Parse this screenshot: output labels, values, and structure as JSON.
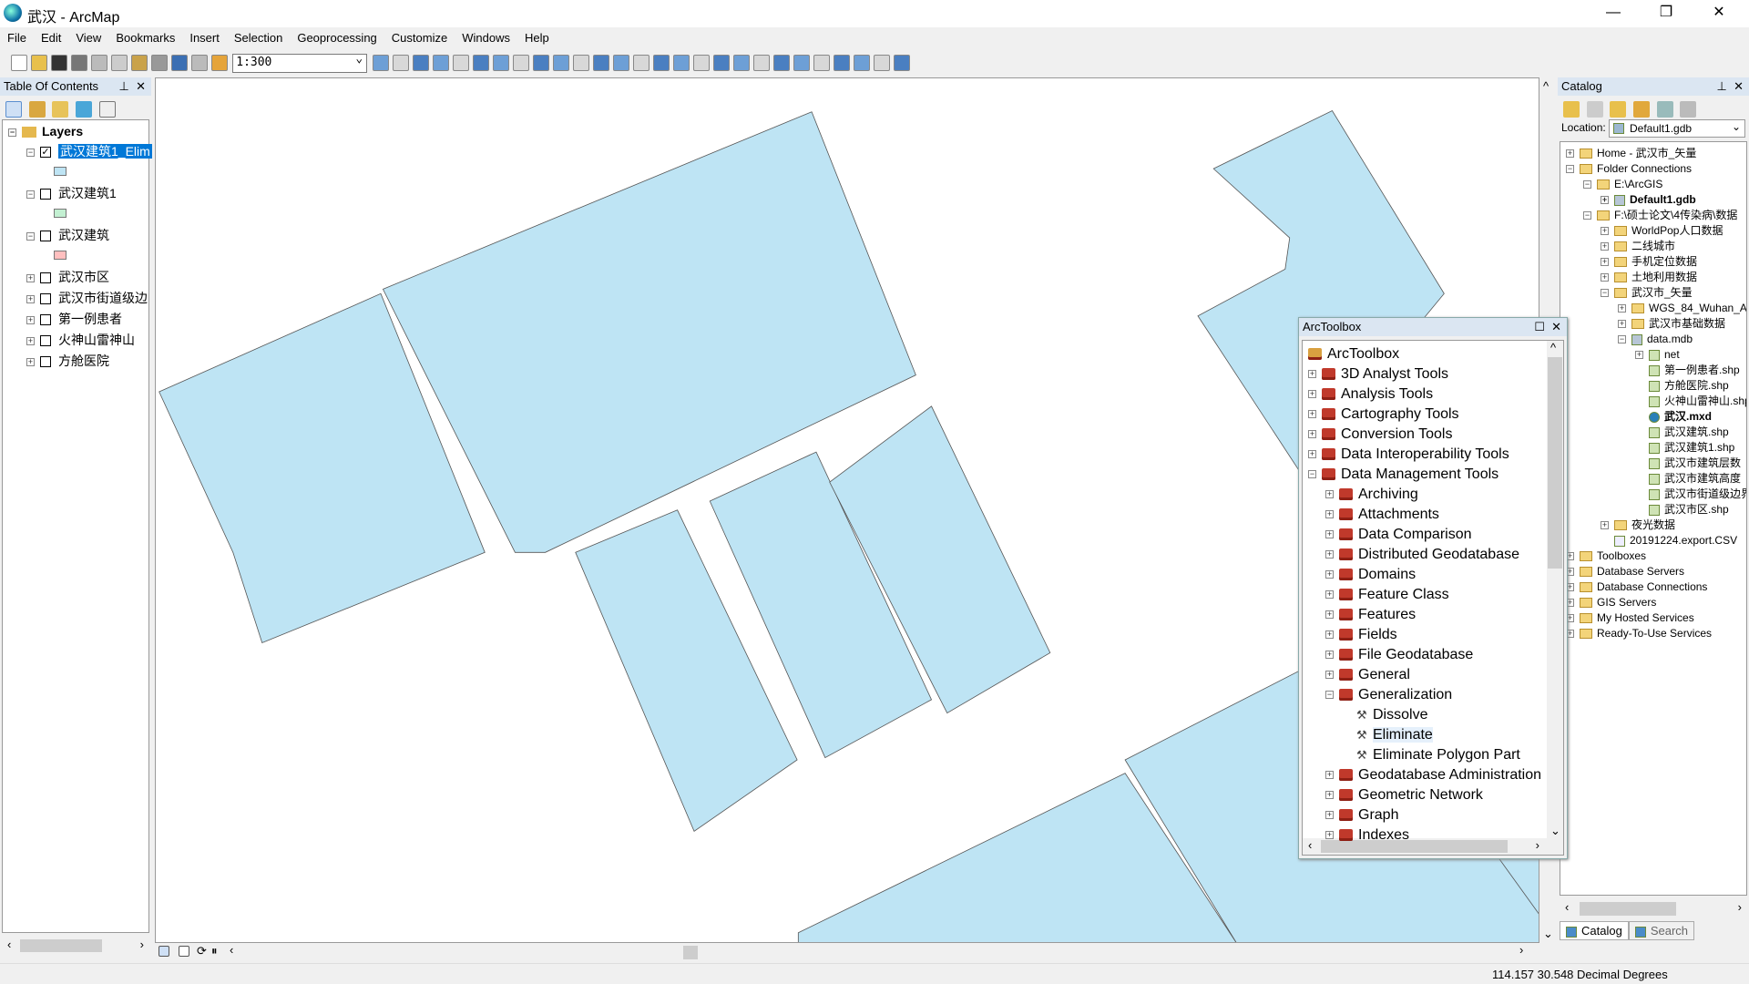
{
  "window": {
    "title": "武汉 - ArcMap",
    "minimize": "—",
    "maximize": "❐",
    "close": "✕"
  },
  "menu": [
    "File",
    "Edit",
    "View",
    "Bookmarks",
    "Insert",
    "Selection",
    "Geoprocessing",
    "Customize",
    "Windows",
    "Help"
  ],
  "toolbar": {
    "scale": "1:300"
  },
  "toc": {
    "title": "Table Of Contents",
    "pin": "⊥",
    "close": "✕",
    "root": "Layers",
    "layers": [
      {
        "name": "武汉建筑1_Elim",
        "checked": true,
        "expanded": true,
        "selected": true,
        "swatch": "#bee4f4"
      },
      {
        "name": "武汉建筑1",
        "checked": false,
        "expanded": true,
        "swatch": "#c3f0d2"
      },
      {
        "name": "武汉建筑",
        "checked": false,
        "expanded": true,
        "swatch": "#ffbfbf"
      },
      {
        "name": "武汉市区",
        "checked": false,
        "expanded": false
      },
      {
        "name": "武汉市街道级边",
        "checked": false,
        "expanded": false
      },
      {
        "name": "第一例患者",
        "checked": false,
        "expanded": false
      },
      {
        "name": "火神山雷神山",
        "checked": false,
        "expanded": false
      },
      {
        "name": "方舱医院",
        "checked": false,
        "expanded": false
      }
    ]
  },
  "map": {
    "fill": "#bee4f4",
    "stroke": "#555555"
  },
  "catalog": {
    "title": "Catalog",
    "location_label": "Location:",
    "location": "Default1.gdb",
    "items": [
      {
        "label": "Home - 武汉市_矢量",
        "level": 0,
        "pm": "+",
        "icon": "folder"
      },
      {
        "label": "Folder Connections",
        "level": 0,
        "pm": "−",
        "icon": "folder"
      },
      {
        "label": "E:\\ArcGIS",
        "level": 1,
        "pm": "−",
        "icon": "folder"
      },
      {
        "label": "Default1.gdb",
        "level": 2,
        "pm": "+",
        "icon": "gdb",
        "bold": true
      },
      {
        "label": "F:\\硕士论文\\4传染病\\数据",
        "level": 1,
        "pm": "−",
        "icon": "folder"
      },
      {
        "label": "WorldPop人口数据",
        "level": 2,
        "pm": "+",
        "icon": "folder"
      },
      {
        "label": "二线城市",
        "level": 2,
        "pm": "+",
        "icon": "folder"
      },
      {
        "label": "手机定位数据",
        "level": 2,
        "pm": "+",
        "icon": "folder"
      },
      {
        "label": "土地利用数据",
        "level": 2,
        "pm": "+",
        "icon": "folder"
      },
      {
        "label": "武汉市_矢量",
        "level": 2,
        "pm": "−",
        "icon": "folder"
      },
      {
        "label": "WGS_84_Wuhan_A",
        "level": 3,
        "pm": "+",
        "icon": "folder"
      },
      {
        "label": "武汉市基础数据",
        "level": 3,
        "pm": "+",
        "icon": "folder"
      },
      {
        "label": "data.mdb",
        "level": 3,
        "pm": "−",
        "icon": "gdb"
      },
      {
        "label": "net",
        "level": 4,
        "pm": "+",
        "icon": "dataset"
      },
      {
        "label": "第一例患者.shp",
        "level": 4,
        "pm": "",
        "icon": "shp"
      },
      {
        "label": "方舱医院.shp",
        "level": 4,
        "pm": "",
        "icon": "shp"
      },
      {
        "label": "火神山雷神山.shp",
        "level": 4,
        "pm": "",
        "icon": "shp"
      },
      {
        "label": "武汉.mxd",
        "level": 4,
        "pm": "",
        "icon": "mxd",
        "bold": true
      },
      {
        "label": "武汉建筑.shp",
        "level": 4,
        "pm": "",
        "icon": "shp"
      },
      {
        "label": "武汉建筑1.shp",
        "level": 4,
        "pm": "",
        "icon": "shp"
      },
      {
        "label": "武汉市建筑层数（备",
        "level": 4,
        "pm": "",
        "icon": "shp"
      },
      {
        "label": "武汉市建筑高度（备",
        "level": 4,
        "pm": "",
        "icon": "shp"
      },
      {
        "label": "武汉市街道级边界.s",
        "level": 4,
        "pm": "",
        "icon": "shp"
      },
      {
        "label": "武汉市区.shp",
        "level": 4,
        "pm": "",
        "icon": "shp"
      },
      {
        "label": "夜光数据",
        "level": 2,
        "pm": "+",
        "icon": "folder"
      },
      {
        "label": "20191224.export.CSV",
        "level": 2,
        "pm": "",
        "icon": "file"
      },
      {
        "label": "Toolboxes",
        "level": 0,
        "pm": "+",
        "icon": "folder"
      },
      {
        "label": "Database Servers",
        "level": 0,
        "pm": "+",
        "icon": "folder"
      },
      {
        "label": "Database Connections",
        "level": 0,
        "pm": "+",
        "icon": "folder"
      },
      {
        "label": "GIS Servers",
        "level": 0,
        "pm": "+",
        "icon": "folder"
      },
      {
        "label": "My Hosted Services",
        "level": 0,
        "pm": "+",
        "icon": "folder"
      },
      {
        "label": "Ready-To-Use Services",
        "level": 0,
        "pm": "+",
        "icon": "folder"
      }
    ],
    "tabs": [
      "Catalog",
      "Search"
    ]
  },
  "toolbox": {
    "title": "ArcToolbox",
    "root": "ArcToolbox",
    "items": [
      {
        "label": "3D Analyst Tools",
        "level": 0,
        "pm": "+",
        "icon": "toolbox"
      },
      {
        "label": "Analysis Tools",
        "level": 0,
        "pm": "+",
        "icon": "toolbox"
      },
      {
        "label": "Cartography Tools",
        "level": 0,
        "pm": "+",
        "icon": "toolbox"
      },
      {
        "label": "Conversion Tools",
        "level": 0,
        "pm": "+",
        "icon": "toolbox"
      },
      {
        "label": "Data Interoperability Tools",
        "level": 0,
        "pm": "+",
        "icon": "toolbox"
      },
      {
        "label": "Data Management Tools",
        "level": 0,
        "pm": "−",
        "icon": "toolbox"
      },
      {
        "label": "Archiving",
        "level": 1,
        "pm": "+",
        "icon": "toolset"
      },
      {
        "label": "Attachments",
        "level": 1,
        "pm": "+",
        "icon": "toolset"
      },
      {
        "label": "Data Comparison",
        "level": 1,
        "pm": "+",
        "icon": "toolset"
      },
      {
        "label": "Distributed Geodatabase",
        "level": 1,
        "pm": "+",
        "icon": "toolset"
      },
      {
        "label": "Domains",
        "level": 1,
        "pm": "+",
        "icon": "toolset"
      },
      {
        "label": "Feature Class",
        "level": 1,
        "pm": "+",
        "icon": "toolset"
      },
      {
        "label": "Features",
        "level": 1,
        "pm": "+",
        "icon": "toolset"
      },
      {
        "label": "Fields",
        "level": 1,
        "pm": "+",
        "icon": "toolset"
      },
      {
        "label": "File Geodatabase",
        "level": 1,
        "pm": "+",
        "icon": "toolset"
      },
      {
        "label": "General",
        "level": 1,
        "pm": "+",
        "icon": "toolset"
      },
      {
        "label": "Generalization",
        "level": 1,
        "pm": "−",
        "icon": "toolset"
      },
      {
        "label": "Dissolve",
        "level": 2,
        "pm": "",
        "icon": "tool"
      },
      {
        "label": "Eliminate",
        "level": 2,
        "pm": "",
        "icon": "tool",
        "selected": true
      },
      {
        "label": "Eliminate Polygon Part",
        "level": 2,
        "pm": "",
        "icon": "tool"
      },
      {
        "label": "Geodatabase Administration",
        "level": 1,
        "pm": "+",
        "icon": "toolset"
      },
      {
        "label": "Geometric Network",
        "level": 1,
        "pm": "+",
        "icon": "toolset"
      },
      {
        "label": "Graph",
        "level": 1,
        "pm": "+",
        "icon": "toolset"
      },
      {
        "label": "Indexes",
        "level": 1,
        "pm": "+",
        "icon": "toolset"
      }
    ]
  },
  "status": {
    "coords": "114.157  30.548 Decimal Degrees"
  }
}
